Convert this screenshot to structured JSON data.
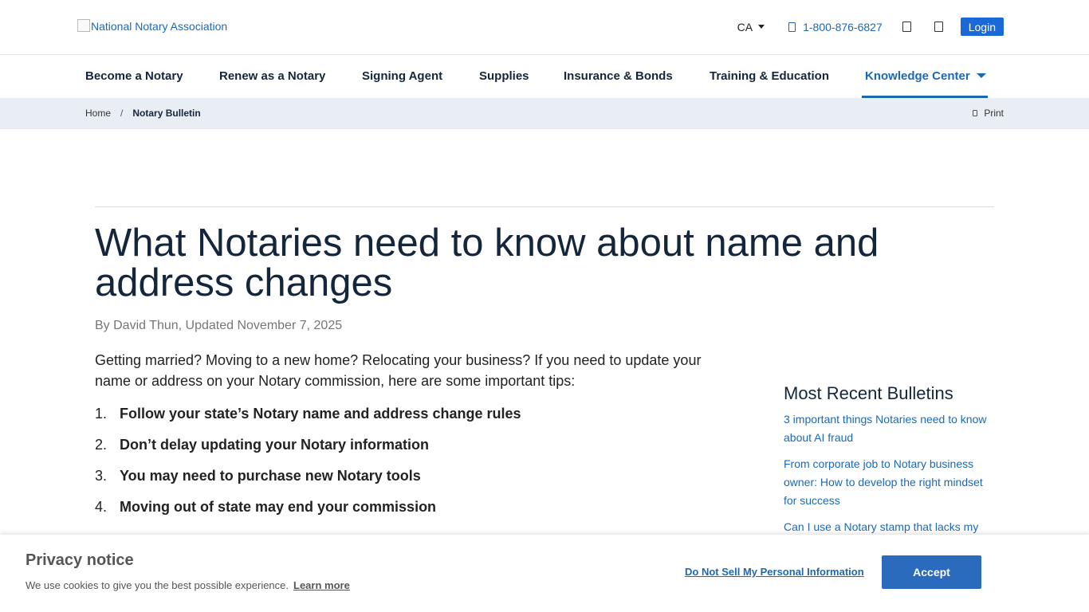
{
  "header": {
    "logo_alt": "National Notary Association",
    "state": "CA",
    "phone": "1-800-876-6827",
    "login_label": "Login"
  },
  "nav": {
    "items": [
      {
        "label": "Become a Notary"
      },
      {
        "label": "Renew as a Notary"
      },
      {
        "label": "Signing Agent"
      },
      {
        "label": "Supplies"
      },
      {
        "label": "Insurance & Bonds"
      },
      {
        "label": "Training & Education"
      },
      {
        "label": "Knowledge Center",
        "active": true
      }
    ]
  },
  "breadcrumb": {
    "home": "Home",
    "separator": "/",
    "current": "Notary Bulletin",
    "print_label": "Print"
  },
  "article": {
    "title": "What Notaries need to know about name and address changes",
    "byline": "By David Thun, Updated November 7, 2025",
    "intro": "Getting married? Moving to a new home? Relocating your business? If you need to update your name or address on your Notary commission, here are some important tips:",
    "tips": [
      {
        "num": "1.",
        "text": "Follow your state’s Notary name and address change rules"
      },
      {
        "num": "2.",
        "text": "Don’t delay updating your Notary information"
      },
      {
        "num": "3.",
        "text": "You may need to purchase new Notary tools"
      },
      {
        "num": "4.",
        "text": "Moving out of state may end your commission"
      }
    ]
  },
  "sidebar": {
    "heading": "Most Recent Bulletins",
    "links": [
      "3 important things Notaries need to know about AI fraud",
      "From corporate job to Notary business owner: How to develop the right mindset for success",
      "Can I use a Notary stamp that lacks my"
    ]
  },
  "privacy": {
    "title": "Privacy notice",
    "body": "We use cookies to give you the best possible experience.",
    "learn_more": "Learn more",
    "do_not_sell": "Do Not Sell My Personal Information",
    "accept": "Accept"
  },
  "colors": {
    "brand_blue": "#1b69b6",
    "heading_navy": "#14263b",
    "breadcrumb_bg": "#e9eef5",
    "accept_bg": "#2a6bbd"
  },
  "icons": {
    "phone": "phone-icon",
    "account": "account-icon",
    "cart": "cart-icon",
    "print": "print-icon"
  }
}
